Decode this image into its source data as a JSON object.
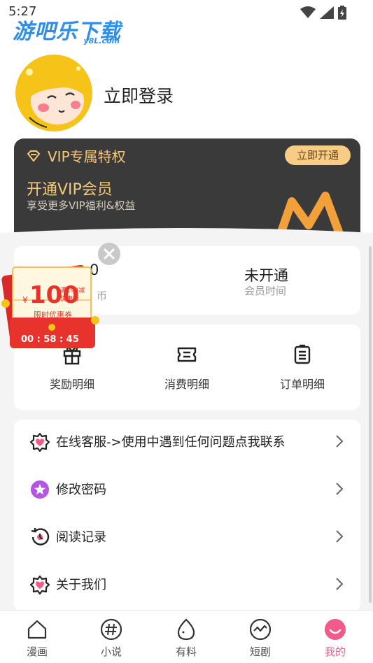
{
  "status_bar": {
    "time": "5:27"
  },
  "watermark": {
    "logo_main": "游吧乐下载",
    "logo_sub": "y8L.com"
  },
  "profile": {
    "login_text": "立即登录"
  },
  "vip": {
    "header": "VIP专属特权",
    "button": "立即开通",
    "title": "开通VIP会员",
    "subtitle": "享受更多VIP福利&权益"
  },
  "stats": {
    "coins_value": "0",
    "coins_label": "币",
    "member_value": "未开通",
    "member_label": "会员时间"
  },
  "promo": {
    "amount": "100",
    "currency": "¥",
    "small_line1": "满199减",
    "small_line2": "优惠券",
    "caption": "限时优惠券",
    "countdown": "00 : 58 : 45"
  },
  "actions": [
    {
      "label": "奖励明细",
      "icon": "gift-icon"
    },
    {
      "label": "消费明细",
      "icon": "ticket-icon"
    },
    {
      "label": "订单明细",
      "icon": "order-list-icon"
    }
  ],
  "menu": [
    {
      "label": "在线客服->使用中遇到任何问题点我联系",
      "icon": "service-icon"
    },
    {
      "label": "修改密码",
      "icon": "star-badge-icon"
    },
    {
      "label": "阅读记录",
      "icon": "history-icon"
    },
    {
      "label": "关于我们",
      "icon": "about-icon"
    }
  ],
  "tabs": [
    {
      "label": "漫画",
      "icon": "home-icon"
    },
    {
      "label": "小说",
      "icon": "hash-icon"
    },
    {
      "label": "有料",
      "icon": "egg-icon"
    },
    {
      "label": "短剧",
      "icon": "pulse-icon"
    },
    {
      "label": "我的",
      "icon": "profile-face-icon"
    }
  ],
  "colors": {
    "vip_gold": "#f5c97a",
    "vip_card_bg": "#3a3a3a",
    "active_tab": "#f25a8a",
    "promo_red": "#e8322c",
    "logo_blue": "#2f8ee8"
  }
}
